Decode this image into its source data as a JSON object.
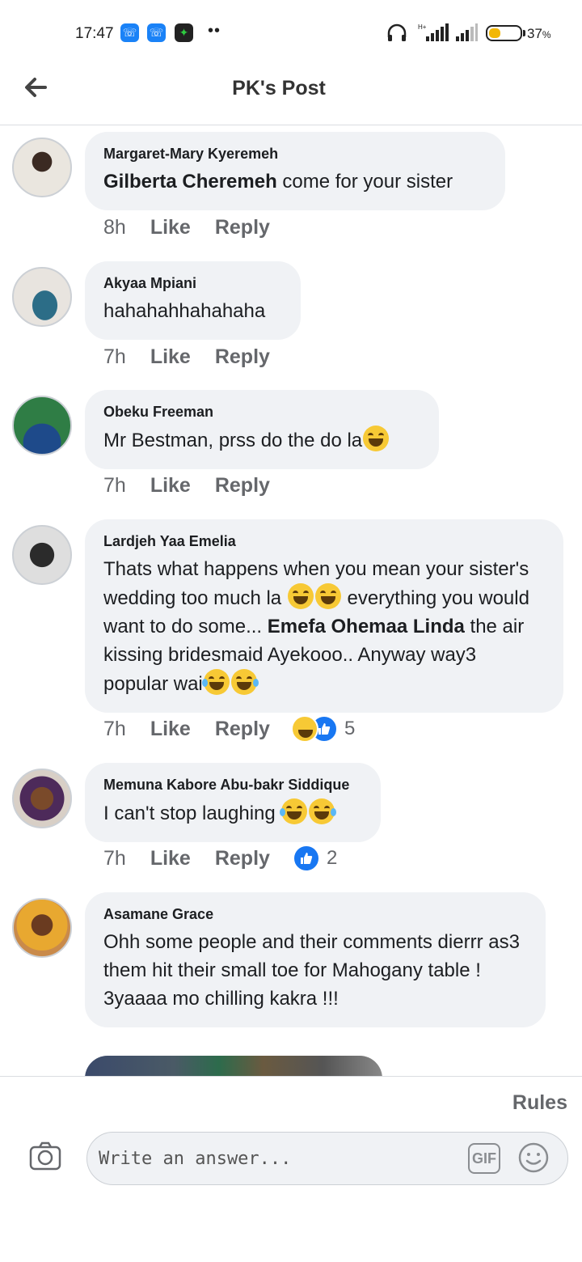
{
  "status_bar": {
    "time": "17:47",
    "battery_percent": "37",
    "battery_suffix": "%",
    "battery_level": 0.37,
    "network": "H+"
  },
  "header": {
    "title": "PK's Post",
    "back_icon": "arrow-left-icon"
  },
  "comments": [
    {
      "author": "Margaret-Mary Kyeremeh",
      "mention": "Gilberta Cheremeh",
      "text": " come for your sister",
      "time": "8h",
      "like_label": "Like",
      "reply_label": "Reply"
    },
    {
      "author": "Akyaa Mpiani",
      "text": "hahahahhahahaha",
      "time": "7h",
      "like_label": "Like",
      "reply_label": "Reply"
    },
    {
      "author": "Obeku Freeman",
      "text": "Mr Bestman, prss do the do la",
      "time": "7h",
      "like_label": "Like",
      "reply_label": "Reply"
    },
    {
      "author": "Lardjeh Yaa Emelia",
      "text_1": "Thats what happens when you mean your sister's wedding too much la ",
      "text_2": " everything you would want to do some... ",
      "mention": "Emefa Ohemaa Linda",
      "text_3": "  the air kissing bridesmaid Ayekooo.. Anyway way3 popular wai",
      "time": "7h",
      "like_label": "Like",
      "reply_label": "Reply",
      "reaction_count": "5"
    },
    {
      "author": "Memuna Kabore Abu-bakr Siddique",
      "text": "I can't stop laughing ",
      "time": "7h",
      "like_label": "Like",
      "reply_label": "Reply",
      "reaction_count": "2"
    },
    {
      "author": "Asamane Grace",
      "text_1": "Ohh some people and their comments dierrr as3 them hit their small toe for Mahogany table !",
      "text_2": "3yaaaa mo chilling kakra !!!"
    }
  ],
  "composer": {
    "rules_label": "Rules",
    "placeholder": "Write an answer...",
    "gif_label": "GIF",
    "camera_icon": "camera-icon",
    "emoji_icon": "smiley-icon"
  },
  "colors": {
    "bubble": "#f0f2f5",
    "meta_text": "#65676b",
    "like_blue": "#1877f2"
  }
}
